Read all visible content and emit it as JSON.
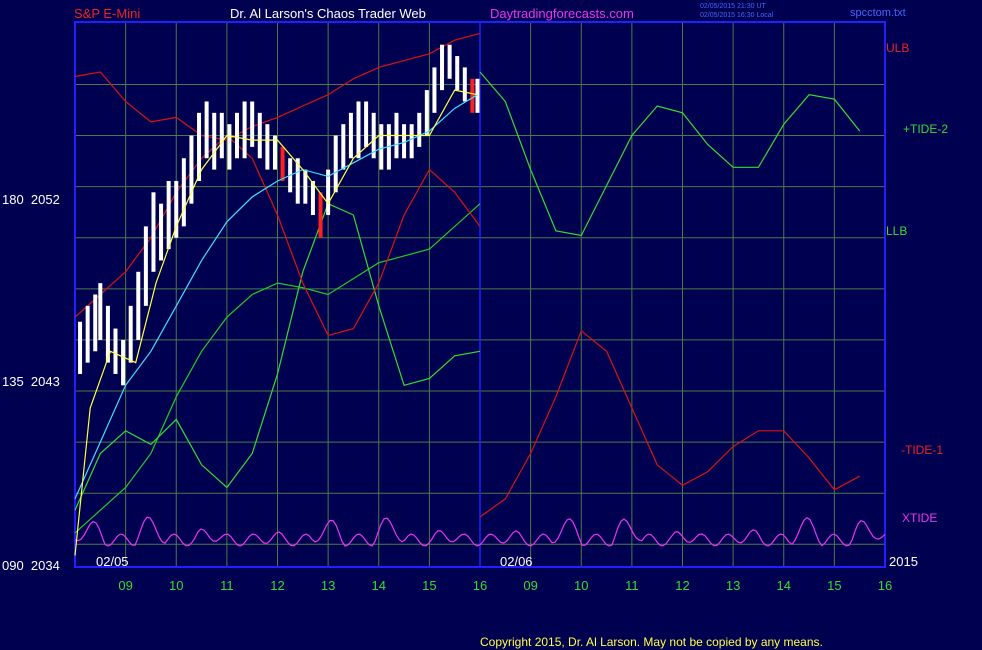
{
  "header": {
    "instrument": "S&P E-Mini",
    "author": "Dr. Al Larson's Chaos Trader Web",
    "site": "Daytradingforecasts.com",
    "stamp_line1": "02/05/2015 21:30 UT",
    "stamp_line2": "02/05/2015 16:30 Local",
    "filename": "spcctom.txt"
  },
  "footer": {
    "copyright": "Copyright 2015, Dr. Al Larson. May not be copied by any means."
  },
  "colors": {
    "background": "#000050",
    "frame": "#2020ff",
    "grid": "#4a7a4a",
    "price_bar": "#ffffff",
    "price_bar_down": "#ff2020",
    "ulb": "#dd1111",
    "llb": "#22cc22",
    "tide_plus2": "#33dd33",
    "tide_minus1": "#dd1111",
    "xtide": "#ee33ee",
    "fast_avg": "#ffff44",
    "slow_avg": "#44ddff"
  },
  "chart_data": {
    "type": "line",
    "title": "S&P E-Mini",
    "y_ticks": [
      {
        "label": "180  2052",
        "value": 2052
      },
      {
        "label": "135  2043",
        "value": 2043
      },
      {
        "label": "090  2034",
        "value": 2034
      }
    ],
    "ylim": [
      2034,
      2058
    ],
    "x_ticks_day1": [
      "09",
      "10",
      "11",
      "12",
      "13",
      "14",
      "15",
      "16"
    ],
    "x_ticks_day2": [
      "09",
      "10",
      "11",
      "12",
      "13",
      "14",
      "15",
      "16"
    ],
    "date_labels": [
      "02/05",
      "02/06"
    ],
    "year_label": "2015",
    "series_labels": {
      "ulb": "ULB",
      "tide_plus2": "+TIDE-2",
      "llb": "LLB",
      "tide_minus1": "-TIDE-1",
      "xtide": "XTIDE"
    },
    "price_bars": [
      [
        8.1,
        2042.5,
        2044.8
      ],
      [
        8.25,
        2043.0,
        2045.5
      ],
      [
        8.4,
        2043.5,
        2046.0
      ],
      [
        8.5,
        2044.0,
        2046.5
      ],
      [
        8.65,
        2043.0,
        2045.5
      ],
      [
        8.8,
        2042.5,
        2044.5
      ],
      [
        8.95,
        2042.0,
        2044.0
      ],
      [
        9.1,
        2043.0,
        2045.5
      ],
      [
        9.25,
        2044.0,
        2047.0
      ],
      [
        9.4,
        2045.5,
        2049.0
      ],
      [
        9.55,
        2047.0,
        2050.5
      ],
      [
        9.7,
        2047.5,
        2050.0
      ],
      [
        9.85,
        2048.0,
        2051.0
      ],
      [
        10.0,
        2048.5,
        2051.0
      ],
      [
        10.15,
        2049.0,
        2052.0
      ],
      [
        10.3,
        2050.0,
        2053.0
      ],
      [
        10.45,
        2051.0,
        2054.0
      ],
      [
        10.6,
        2052.0,
        2054.5
      ],
      [
        10.75,
        2051.5,
        2054.0
      ],
      [
        10.9,
        2052.0,
        2054.0
      ],
      [
        11.05,
        2051.5,
        2053.5
      ],
      [
        11.2,
        2052.0,
        2054.0
      ],
      [
        11.35,
        2052.0,
        2054.5
      ],
      [
        11.5,
        2052.5,
        2054.5
      ],
      [
        11.65,
        2052.0,
        2054.0
      ],
      [
        11.8,
        2051.5,
        2053.5
      ],
      [
        11.95,
        2051.5,
        2053.0
      ],
      [
        12.1,
        2051.0,
        2052.5
      ],
      [
        12.25,
        2050.5,
        2052.0
      ],
      [
        12.4,
        2050.0,
        2052.0
      ],
      [
        12.55,
        2050.0,
        2051.5
      ],
      [
        12.7,
        2049.5,
        2051.0
      ],
      [
        12.85,
        2048.5,
        2050.5
      ],
      [
        13.0,
        2049.5,
        2051.5
      ],
      [
        13.15,
        2050.5,
        2053.0
      ],
      [
        13.3,
        2051.5,
        2053.5
      ],
      [
        13.45,
        2052.0,
        2054.0
      ],
      [
        13.6,
        2052.0,
        2054.5
      ],
      [
        13.75,
        2052.5,
        2054.5
      ],
      [
        13.9,
        2052.0,
        2054.0
      ],
      [
        14.05,
        2051.5,
        2053.5
      ],
      [
        14.2,
        2051.5,
        2053.5
      ],
      [
        14.35,
        2052.0,
        2054.0
      ],
      [
        14.5,
        2052.0,
        2053.5
      ],
      [
        14.65,
        2052.0,
        2053.5
      ],
      [
        14.8,
        2052.5,
        2054.0
      ],
      [
        14.95,
        2053.0,
        2055.0
      ],
      [
        15.1,
        2054.0,
        2056.0
      ],
      [
        15.25,
        2055.0,
        2057.0
      ],
      [
        15.4,
        2055.5,
        2057.0
      ],
      [
        15.55,
        2055.0,
        2056.5
      ],
      [
        15.7,
        2054.5,
        2056.0
      ],
      [
        15.85,
        2054.0,
        2055.5
      ],
      [
        15.95,
        2054.0,
        2055.5
      ]
    ],
    "ulb": [
      [
        8.0,
        2055.6
      ],
      [
        8.5,
        2055.8
      ],
      [
        9.0,
        2054.5
      ],
      [
        9.5,
        2053.6
      ],
      [
        10.0,
        2053.8
      ],
      [
        10.5,
        2053.0
      ],
      [
        11.0,
        2052.8
      ],
      [
        11.5,
        2053.4
      ],
      [
        12.0,
        2053.8
      ],
      [
        12.5,
        2054.3
      ],
      [
        13.0,
        2054.8
      ],
      [
        13.5,
        2055.5
      ],
      [
        14.0,
        2056.0
      ],
      [
        14.5,
        2056.3
      ],
      [
        15.0,
        2056.6
      ],
      [
        15.5,
        2057.2
      ],
      [
        16.0,
        2057.5
      ]
    ],
    "llb": [
      [
        8.0,
        2035.5
      ],
      [
        8.5,
        2036.5
      ],
      [
        9.0,
        2037.5
      ],
      [
        9.5,
        2039.0
      ],
      [
        10.0,
        2041.5
      ],
      [
        10.5,
        2043.5
      ],
      [
        11.0,
        2045.0
      ],
      [
        11.5,
        2046.0
      ],
      [
        12.0,
        2046.5
      ],
      [
        12.5,
        2046.3
      ],
      [
        13.0,
        2046.0
      ],
      [
        13.5,
        2046.7
      ],
      [
        14.0,
        2047.4
      ],
      [
        14.5,
        2047.7
      ],
      [
        15.0,
        2048.0
      ],
      [
        15.5,
        2049.0
      ],
      [
        16.0,
        2050.0
      ]
    ],
    "tide_plus2_hist": [
      [
        8.0,
        2036.5
      ],
      [
        8.5,
        2039.0
      ],
      [
        9.0,
        2040.0
      ],
      [
        9.5,
        2039.4
      ],
      [
        10.0,
        2040.5
      ],
      [
        10.5,
        2038.5
      ],
      [
        11.0,
        2037.5
      ],
      [
        11.5,
        2039.0
      ],
      [
        12.0,
        2042.5
      ],
      [
        12.5,
        2047.0
      ],
      [
        13.0,
        2050.0
      ],
      [
        13.5,
        2049.5
      ],
      [
        14.0,
        2045.5
      ],
      [
        14.5,
        2042.0
      ],
      [
        15.0,
        2042.3
      ],
      [
        15.5,
        2043.3
      ],
      [
        16.0,
        2043.5
      ]
    ],
    "tide_plus2_fcst": [
      [
        16.0,
        2055.8
      ],
      [
        16.5,
        2054.5
      ],
      [
        17.0,
        2051.5
      ],
      [
        17.5,
        2048.8
      ],
      [
        18.0,
        2048.6
      ],
      [
        18.5,
        2050.8
      ],
      [
        19.0,
        2053.0
      ],
      [
        19.5,
        2054.3
      ],
      [
        20.0,
        2054.0
      ],
      [
        20.5,
        2052.6
      ],
      [
        21.0,
        2051.6
      ],
      [
        21.5,
        2051.6
      ],
      [
        22.0,
        2053.5
      ],
      [
        22.5,
        2054.8
      ],
      [
        23.0,
        2054.6
      ],
      [
        23.5,
        2053.2
      ]
    ],
    "tide_minus1_hist": [
      [
        8.0,
        2045.0
      ],
      [
        8.5,
        2046.0
      ],
      [
        9.0,
        2047.0
      ],
      [
        9.5,
        2048.5
      ],
      [
        10.0,
        2050.5
      ],
      [
        10.5,
        2052.0
      ],
      [
        11.0,
        2053.0
      ],
      [
        11.5,
        2052.0
      ],
      [
        12.0,
        2049.5
      ],
      [
        12.5,
        2046.5
      ],
      [
        13.0,
        2044.2
      ],
      [
        13.5,
        2044.5
      ],
      [
        14.0,
        2046.5
      ],
      [
        14.5,
        2049.5
      ],
      [
        15.0,
        2051.5
      ],
      [
        15.5,
        2050.5
      ],
      [
        16.0,
        2049.0
      ]
    ],
    "tide_minus1_fcst": [
      [
        16.0,
        2036.2
      ],
      [
        16.5,
        2037.0
      ],
      [
        17.0,
        2039.0
      ],
      [
        17.5,
        2041.5
      ],
      [
        18.0,
        2044.4
      ],
      [
        18.5,
        2043.5
      ],
      [
        19.0,
        2041.0
      ],
      [
        19.5,
        2038.5
      ],
      [
        20.0,
        2037.6
      ],
      [
        20.5,
        2038.2
      ],
      [
        21.0,
        2039.3
      ],
      [
        21.5,
        2040.0
      ],
      [
        22.0,
        2040.0
      ],
      [
        22.5,
        2038.8
      ],
      [
        23.0,
        2037.4
      ],
      [
        23.5,
        2038.0
      ]
    ],
    "fast_avg": [
      [
        8.0,
        2034.5
      ],
      [
        8.3,
        2041.0
      ],
      [
        8.7,
        2043.5
      ],
      [
        9.2,
        2043.0
      ],
      [
        9.6,
        2046.5
      ],
      [
        10.0,
        2049.0
      ],
      [
        10.5,
        2051.5
      ],
      [
        11.0,
        2053.0
      ],
      [
        11.5,
        2052.8
      ],
      [
        12.0,
        2052.8
      ],
      [
        12.5,
        2051.5
      ],
      [
        13.0,
        2050.0
      ],
      [
        13.5,
        2052.0
      ],
      [
        14.0,
        2053.0
      ],
      [
        14.5,
        2053.0
      ],
      [
        15.0,
        2053.0
      ],
      [
        15.5,
        2055.0
      ],
      [
        15.95,
        2054.8
      ]
    ],
    "slow_avg": [
      [
        8.0,
        2037.0
      ],
      [
        8.5,
        2039.5
      ],
      [
        9.0,
        2042.0
      ],
      [
        9.5,
        2043.5
      ],
      [
        10.0,
        2045.5
      ],
      [
        10.5,
        2047.5
      ],
      [
        11.0,
        2049.2
      ],
      [
        11.5,
        2050.3
      ],
      [
        12.0,
        2051.0
      ],
      [
        12.5,
        2051.5
      ],
      [
        13.0,
        2051.2
      ],
      [
        13.5,
        2051.8
      ],
      [
        14.0,
        2052.4
      ],
      [
        14.5,
        2052.7
      ],
      [
        15.0,
        2053.2
      ],
      [
        15.5,
        2054.2
      ],
      [
        15.95,
        2054.8
      ]
    ]
  }
}
